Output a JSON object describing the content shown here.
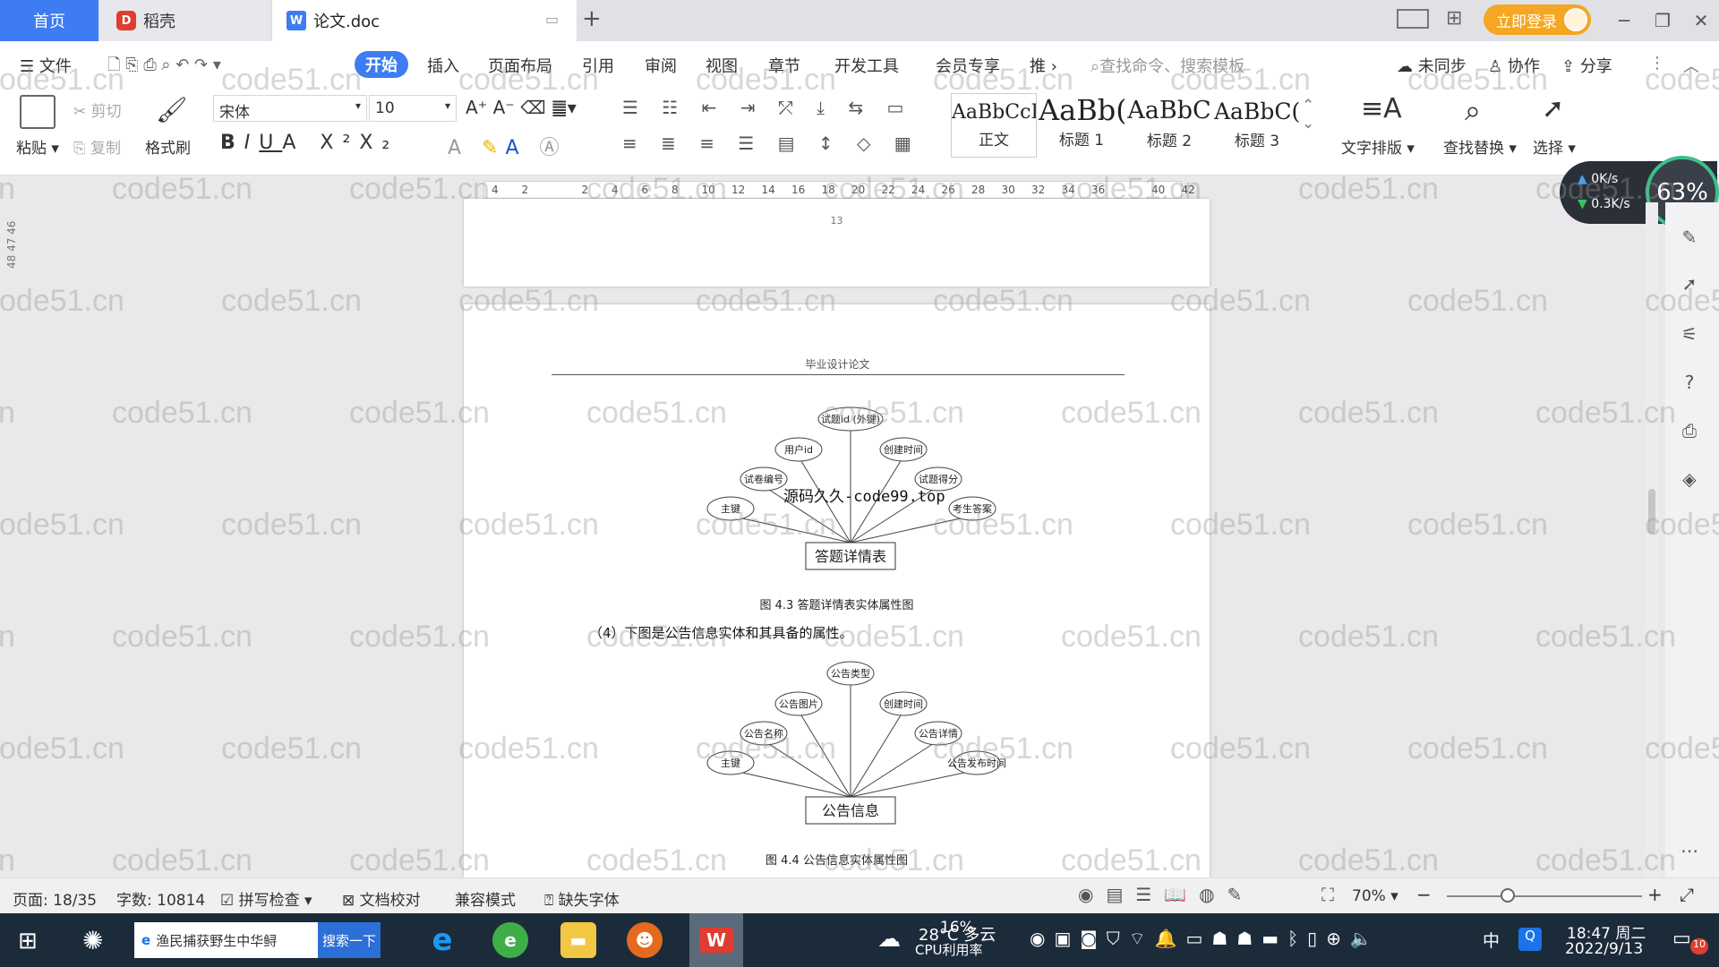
{
  "tabs": {
    "home": "首页",
    "docer": "稻壳",
    "doc": "论文.doc"
  },
  "window": {
    "login": "立即登录"
  },
  "menu": [
    "文件",
    "开始",
    "插入",
    "页面布局",
    "引用",
    "审阅",
    "视图",
    "章节",
    "开发工具",
    "会员专享",
    "推"
  ],
  "menu_right": {
    "search": "查找命令、搜索模板",
    "sync": "未同步",
    "collab": "协作",
    "share": "分享"
  },
  "ribbon": {
    "paste": "粘贴",
    "cut": "剪切",
    "copy": "复制",
    "format_painter": "格式刷",
    "font": "宋体",
    "size": "10",
    "text_layout": "文字排版",
    "find_replace": "查找替换",
    "select": "选择"
  },
  "styles": [
    {
      "sample": "AaBbCcI",
      "name": "正文"
    },
    {
      "sample": "AaBb(",
      "name": "标题 1"
    },
    {
      "sample": "AaBbC",
      "name": "标题 2"
    },
    {
      "sample": "AaBbC(",
      "name": "标题 3"
    }
  ],
  "ruler": [
    "4",
    "2",
    "",
    "2",
    "4",
    "6",
    "8",
    "10",
    "12",
    "14",
    "16",
    "18",
    "20",
    "22",
    "24",
    "26",
    "28",
    "30",
    "32",
    "34",
    "36",
    "",
    "40",
    "42"
  ],
  "net": {
    "up": "0K/s",
    "down": "0.3K/s",
    "cpu": "63%"
  },
  "left_margin": "48 47 46",
  "page1": {
    "page_number": "13"
  },
  "page2": {
    "header": "毕业设计论文",
    "overlay": "源码久久-code99.top",
    "er1": {
      "entity": "答题详情表",
      "attrs": [
        "主键",
        "试卷编号",
        "用户id",
        "试题id (外键)",
        "创建时间",
        "试题得分",
        "考生答案"
      ],
      "caption": "图 4.3 答题详情表实体属性图"
    },
    "para": "（4）下图是公告信息实体和其具备的属性。",
    "er2": {
      "entity": "公告信息",
      "attrs": [
        "主键",
        "公告名称",
        "公告图片",
        "公告类型",
        "创建时间",
        "公告详情",
        "公告发布时间"
      ],
      "caption": "图 4.4 公告信息实体属性图"
    }
  },
  "watermark": "code51.cn",
  "status": {
    "page": "页面: 18/35",
    "words": "字数: 10814",
    "spell": "拼写检查",
    "proof": "文档校对",
    "compat": "兼容模式",
    "font_missing": "缺失字体",
    "zoom": "70%"
  },
  "taskbar": {
    "search_text": "渔民捕获野生中华鲟",
    "search_btn": "搜索一下",
    "weather": "28°C 多云",
    "cpu": "16%",
    "cpu_label": "CPU利用率",
    "ime": "中",
    "time": "18:47 周二",
    "date": "2022/9/13",
    "notif": "10"
  }
}
